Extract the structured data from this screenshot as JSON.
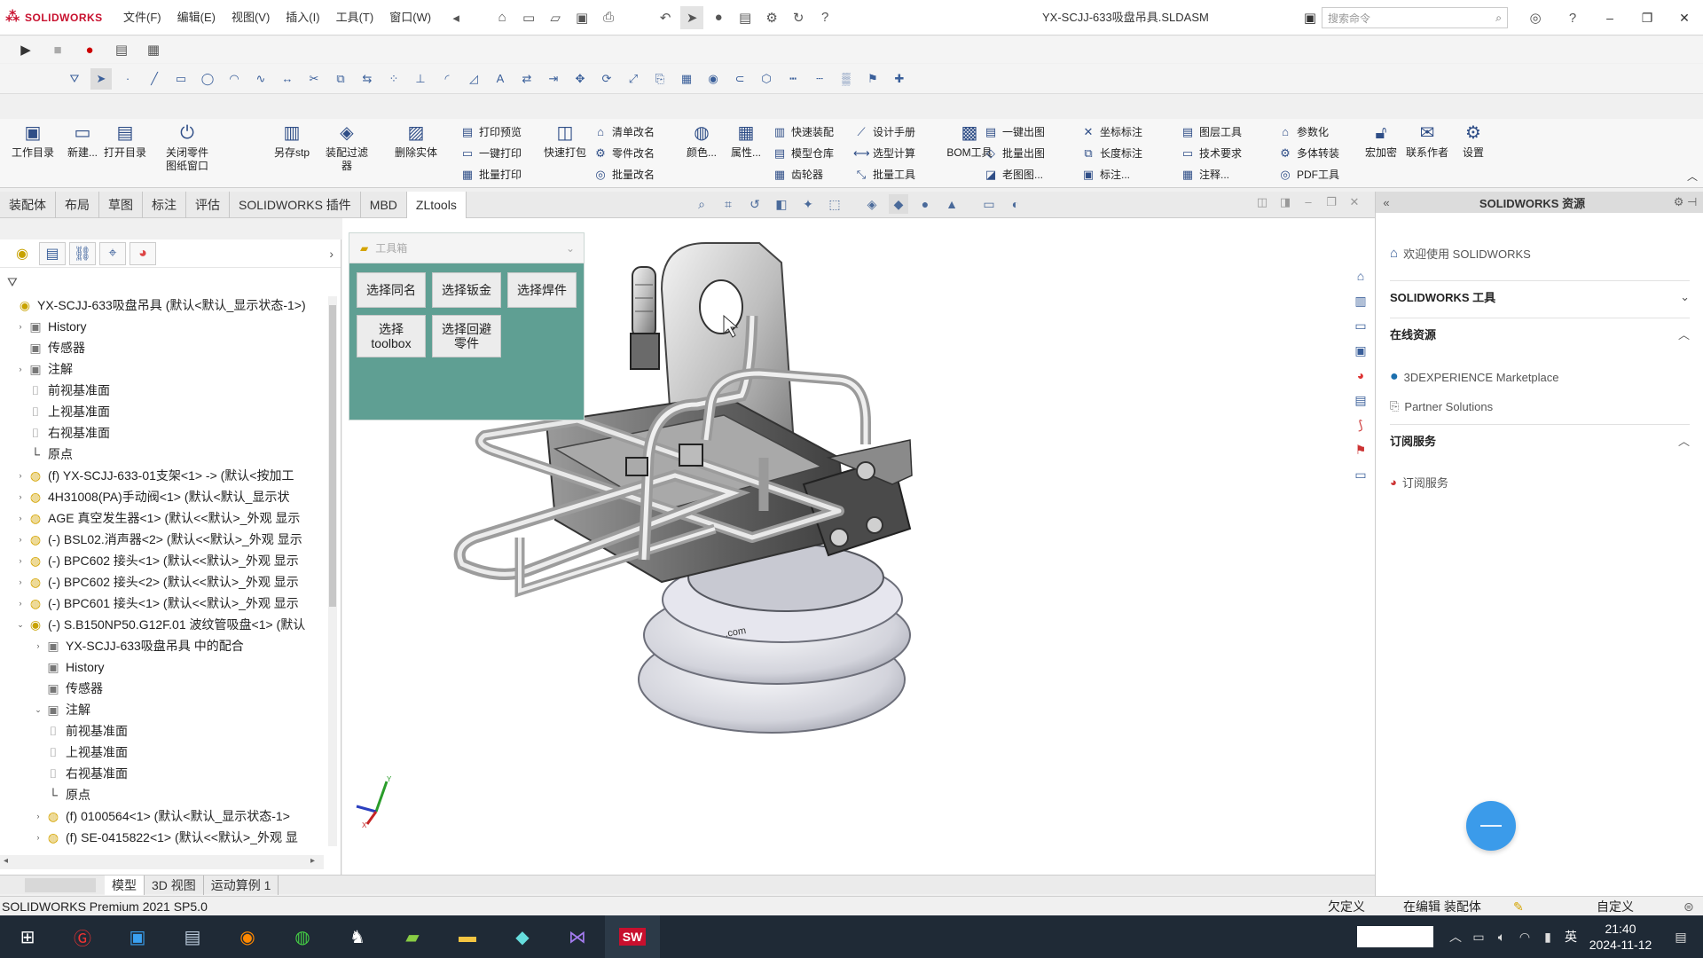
{
  "app": {
    "logo": "SOLIDWORKS",
    "menus": [
      "文件(F)",
      "编辑(E)",
      "视图(V)",
      "插入(I)",
      "工具(T)",
      "窗口(W)"
    ],
    "document_title": "YX-SCJJ-633吸盘吊具.SLDASM",
    "search_placeholder": "搜索命令"
  },
  "ribbon": {
    "big": [
      {
        "label": "工作目录",
        "icon": "folder-icon"
      },
      {
        "label": "新建...",
        "icon": "new-doc-icon"
      },
      {
        "label": "打开目录",
        "icon": "open-folder-icon"
      },
      {
        "label": "关闭零件图纸窗口",
        "icon": "power-icon"
      },
      {
        "label": "另存stp",
        "icon": "save-stp-icon"
      },
      {
        "label": "装配过滤器",
        "icon": "filter-icon"
      },
      {
        "label": "删除实体",
        "icon": "delete-icon"
      },
      {
        "label": "快速打包",
        "icon": "pack-icon"
      },
      {
        "label": "颜色...",
        "icon": "color-icon"
      },
      {
        "label": "属性...",
        "icon": "property-icon"
      },
      {
        "label": "BOM工具",
        "icon": "bom-icon"
      },
      {
        "label": "宏加密",
        "icon": "lock-icon"
      },
      {
        "label": "联系作者",
        "icon": "contact-icon"
      },
      {
        "label": "设置",
        "icon": "settings-icon"
      }
    ],
    "small": [
      "打印预览",
      "一键打印",
      "批量打印",
      "清单改名",
      "零件改名",
      "批量改名",
      "快速装配",
      "模型仓库",
      "齿轮器",
      "设计手册",
      "选型计算",
      "批量工具",
      "一键出图",
      "批量出图",
      "老图图...",
      "坐标标注",
      "长度标注",
      "标注...",
      "图层工具",
      "技术要求",
      "注释...",
      "参数化",
      "多体转装",
      "PDF工具"
    ]
  },
  "command_tabs": [
    "装配体",
    "布局",
    "草图",
    "标注",
    "评估",
    "SOLIDWORKS 插件",
    "MBD",
    "ZLtools"
  ],
  "feature_tree": [
    {
      "label": "YX-SCJJ-633吸盘吊具 (默认<默认_显示状态-1>)",
      "indent": 0,
      "icon": "asm",
      "arrow": ""
    },
    {
      "label": "History",
      "indent": 1,
      "icon": "fold",
      "arrow": "›"
    },
    {
      "label": "传感器",
      "indent": 1,
      "icon": "fold",
      "arrow": ""
    },
    {
      "label": "注解",
      "indent": 1,
      "icon": "fold",
      "arrow": "›"
    },
    {
      "label": "前视基准面",
      "indent": 1,
      "icon": "plane",
      "arrow": ""
    },
    {
      "label": "上视基准面",
      "indent": 1,
      "icon": "plane",
      "arrow": ""
    },
    {
      "label": "右视基准面",
      "indent": 1,
      "icon": "plane",
      "arrow": ""
    },
    {
      "label": "原点",
      "indent": 1,
      "icon": "orig",
      "arrow": ""
    },
    {
      "label": "(f) YX-SCJJ-633-01支架<1> -> (默认<按加工",
      "indent": 1,
      "icon": "part",
      "arrow": "›"
    },
    {
      "label": "4H31008(PA)手动阀<1> (默认<默认_显示状",
      "indent": 1,
      "icon": "part",
      "arrow": "›"
    },
    {
      "label": "AGE 真空发生器<1> (默认<<默认>_外观 显示",
      "indent": 1,
      "icon": "part",
      "arrow": "›"
    },
    {
      "label": "(-) BSL02.消声器<2> (默认<<默认>_外观 显示",
      "indent": 1,
      "icon": "part",
      "arrow": "›"
    },
    {
      "label": "(-) BPC602 接头<1> (默认<<默认>_外观 显示",
      "indent": 1,
      "icon": "part",
      "arrow": "›"
    },
    {
      "label": "(-) BPC602 接头<2> (默认<<默认>_外观 显示",
      "indent": 1,
      "icon": "part",
      "arrow": "›"
    },
    {
      "label": "(-) BPC601 接头<1> (默认<<默认>_外观 显示",
      "indent": 1,
      "icon": "part",
      "arrow": "›"
    },
    {
      "label": "(-) S.B150NP50.G12F.01 波纹管吸盘<1> (默认",
      "indent": 1,
      "icon": "asm",
      "arrow": "⌄"
    },
    {
      "label": "YX-SCJJ-633吸盘吊具 中的配合",
      "indent": 2,
      "icon": "fold",
      "arrow": "›"
    },
    {
      "label": "History",
      "indent": 2,
      "icon": "fold",
      "arrow": ""
    },
    {
      "label": "传感器",
      "indent": 2,
      "icon": "fold",
      "arrow": ""
    },
    {
      "label": "注解",
      "indent": 2,
      "icon": "fold",
      "arrow": "⌄"
    },
    {
      "label": "前视基准面",
      "indent": 2,
      "icon": "plane",
      "arrow": ""
    },
    {
      "label": "上视基准面",
      "indent": 2,
      "icon": "plane",
      "arrow": ""
    },
    {
      "label": "右视基准面",
      "indent": 2,
      "icon": "plane",
      "arrow": ""
    },
    {
      "label": "原点",
      "indent": 2,
      "icon": "orig",
      "arrow": ""
    },
    {
      "label": "(f) 0100564<1> (默认<默认_显示状态-1>",
      "indent": 2,
      "icon": "part",
      "arrow": "›"
    },
    {
      "label": "(f) SE-0415822<1> (默认<<默认>_外观 显",
      "indent": 2,
      "icon": "part",
      "arrow": "›"
    }
  ],
  "tool_panel": {
    "title": "工具箱",
    "buttons": [
      "选择同名",
      "选择钣金",
      "选择焊件",
      "选择toolbox",
      "选择回避零件"
    ]
  },
  "task_pane": {
    "title": "SOLIDWORKS 资源",
    "welcome": "欢迎使用 SOLIDWORKS",
    "sections": [
      {
        "title": "SOLIDWORKS 工具",
        "items": []
      },
      {
        "title": "在线资源",
        "items": [
          "3DEXPERIENCE Marketplace",
          "Partner Solutions"
        ]
      },
      {
        "title": "订阅服务",
        "items": [
          "订阅服务"
        ]
      }
    ]
  },
  "bottom_tabs": [
    "模型",
    "3D 视图",
    "运动算例 1"
  ],
  "status": {
    "left": "SOLIDWORKS Premium 2021 SP5.0",
    "state": "欠定义",
    "mode": "在编辑 装配体",
    "custom": "自定义"
  },
  "tray": {
    "ime": "英",
    "time": "21:40",
    "date": "2024-11-12"
  },
  "colors": {
    "panel_bg": "#5f9f93",
    "brand_red": "#c8102e",
    "taskbar": "#1f2a36",
    "assistant_blue": "#3b9bea"
  }
}
